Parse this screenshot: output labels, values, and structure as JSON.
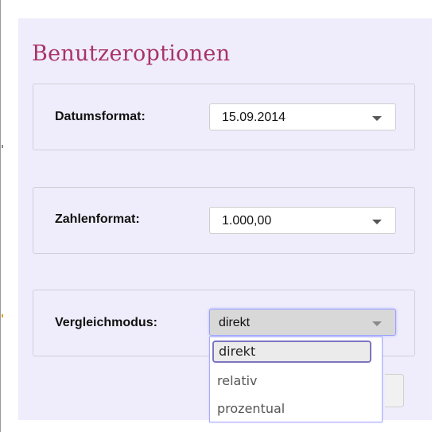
{
  "dialog": {
    "title": "Benutzeroptionen"
  },
  "date_format": {
    "label": "Datumsformat:",
    "value": "15.09.2014"
  },
  "number_format": {
    "label": "Zahlenformat:",
    "value": "1.000,00"
  },
  "comparison_mode": {
    "label": "Vergleichmodus:",
    "value": "direkt",
    "options": [
      "direkt",
      "relativ",
      "prozentual"
    ]
  },
  "colors": {
    "title": "#a8336a",
    "panel_background": "#efedfb",
    "focus_border": "#9aa0ff",
    "selected_option_border": "#7e75c2"
  },
  "icons": {
    "dropdown_caret": "chevron-down-icon"
  }
}
